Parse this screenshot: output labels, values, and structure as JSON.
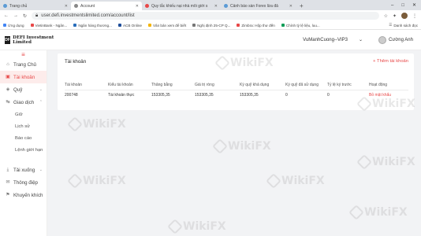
{
  "browser": {
    "tabs": [
      {
        "label": "Trang chủ",
        "color": "#5b9bd5"
      },
      {
        "label": "Account",
        "color": "#888888"
      },
      {
        "label": "Quy tắc khiếu nại nhà môi giới s",
        "color": "#e84848"
      },
      {
        "label": "Cảnh báo sàn Forex lừa đả",
        "color": "#5b9bd5"
      }
    ],
    "active_tab": 1,
    "new_tab": "+",
    "url": "user.defi.investmentslimited.com/account/list",
    "bookmarks": [
      {
        "label": "Ứng dụng",
        "color": "#4285f4"
      },
      {
        "label": "VietinBank - Ngân...",
        "color": "#e84848"
      },
      {
        "label": "Ngân hàng thương...",
        "color": "#2a6ebb"
      },
      {
        "label": "ACB Online",
        "color": "#1f4e9a"
      },
      {
        "label": "Vân bản xem để biết",
        "color": "#f4b400"
      },
      {
        "label": "Nghị định 25-CP Q...",
        "color": "#777777"
      },
      {
        "label": "Zimbra: Hộp thư đến",
        "color": "#e84848"
      },
      {
        "label": "Chính tỷ lệ liệu, luu...",
        "color": "#0f9d58"
      }
    ],
    "bookmarks_other": "Danh sách đọc"
  },
  "header": {
    "logo_mark": "DF",
    "logo_text": "DEFI Investment Limited",
    "account_selector": "VuManhCuong--VIP3",
    "user_name": "Cường Anh"
  },
  "sidebar": {
    "items": [
      {
        "label": "Trang Chủ",
        "icon": "home-icon",
        "glyph": "⌂"
      },
      {
        "label": "Tài khoản",
        "icon": "account-icon",
        "glyph": "▣"
      },
      {
        "label": "Quỹ",
        "icon": "fund-icon",
        "glyph": "◈"
      },
      {
        "label": "Giao dịch",
        "icon": "trade-icon",
        "glyph": "↹"
      }
    ],
    "sub_items": [
      "Giữ",
      "Lịch sử",
      "Báo cáo",
      "Lệnh giới hạn"
    ],
    "bottom_items": [
      {
        "label": "Tải xuống",
        "icon": "download-icon",
        "glyph": "⤓"
      },
      {
        "label": "Thông điệp",
        "icon": "message-icon",
        "glyph": "✉"
      },
      {
        "label": "Khuyến khích",
        "icon": "promotion-icon",
        "glyph": "⚑"
      }
    ]
  },
  "panel": {
    "title": "Tài khoản",
    "add_label": "+ Thêm tài khoản",
    "columns": [
      "Tài khoản",
      "Kiểu tài khoản",
      "Thăng bằng",
      "Giá trị ròng",
      "Ký quỹ khả dụng",
      "Ký quỹ đã sử dụng",
      "Tỷ lệ ký trước",
      "Hoạt động"
    ],
    "rows": [
      [
        "200748",
        "Tài khoản thực",
        "153305,35",
        "153305,35",
        "153305,35",
        "0",
        "0",
        "Bỏ mật khẩu"
      ]
    ]
  },
  "watermark": "WikiFX",
  "colors": {
    "accent": "#e84848"
  }
}
